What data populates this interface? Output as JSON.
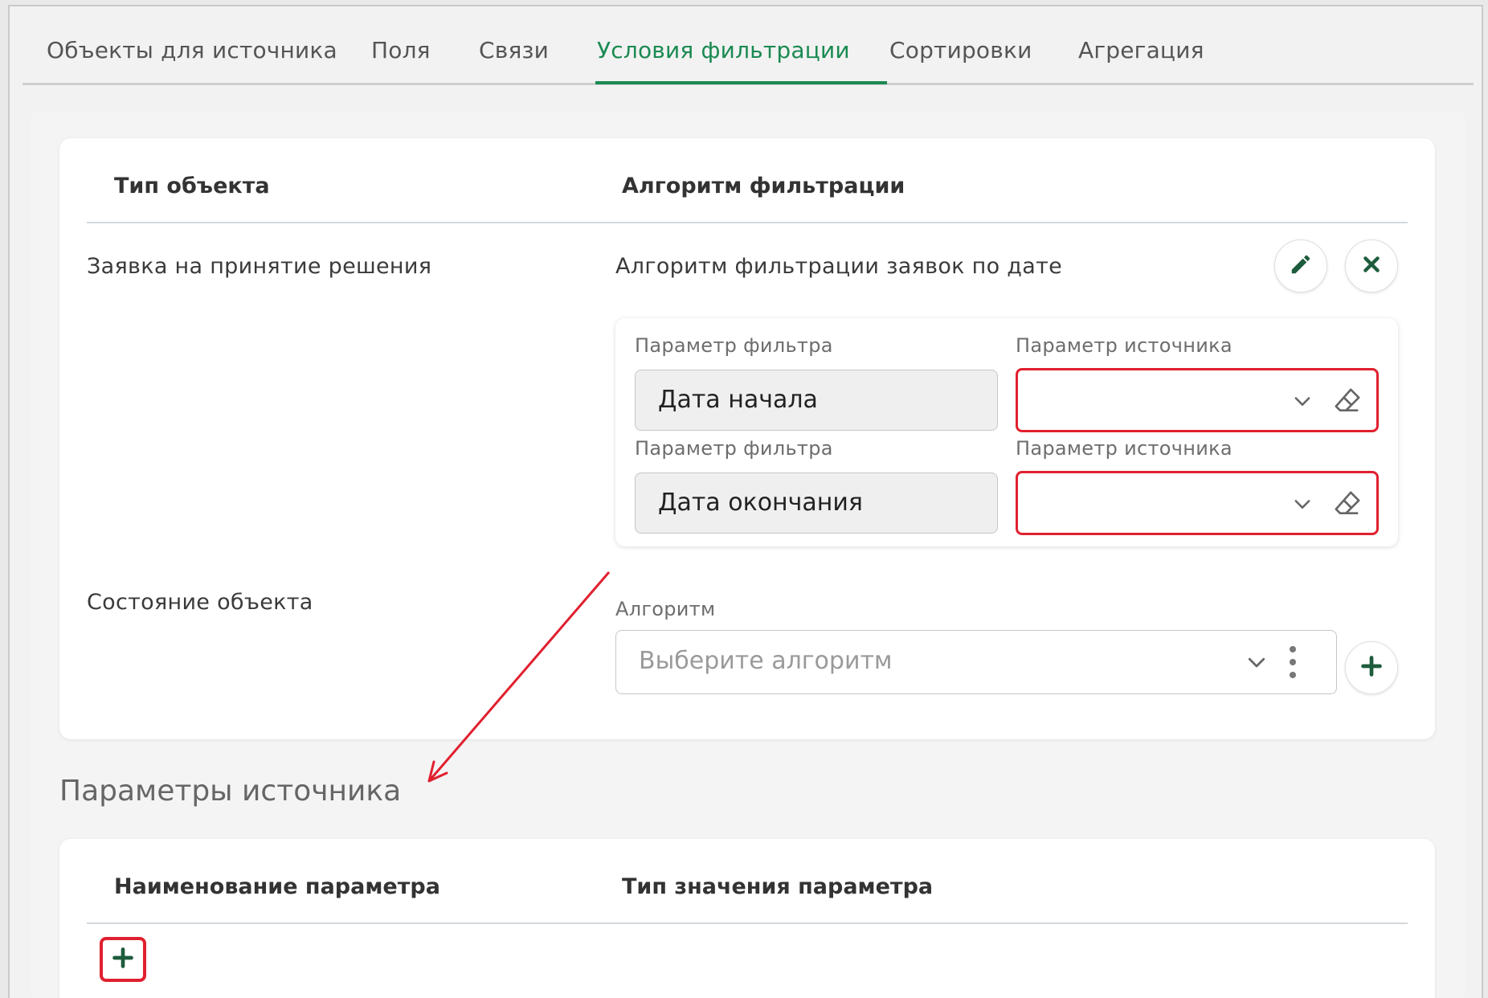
{
  "tabs": [
    {
      "label": "Объекты для источника",
      "active": false
    },
    {
      "label": "Поля",
      "active": false
    },
    {
      "label": "Связи",
      "active": false
    },
    {
      "label": "Условия фильтрации",
      "active": true
    },
    {
      "label": "Сортировки",
      "active": false
    },
    {
      "label": "Агрегация",
      "active": false
    }
  ],
  "filters_table": {
    "headers": {
      "object_type": "Тип объекта",
      "algorithm": "Алгоритм фильтрации"
    },
    "rows": [
      {
        "object_type": "Заявка на принятие решения",
        "algorithm": "Алгоритм фильтрации заявок по дате",
        "params": [
          {
            "filter_label": "Параметр фильтра",
            "filter_value": "Дата начала",
            "source_label": "Параметр источника",
            "source_value": ""
          },
          {
            "filter_label": "Параметр фильтра",
            "filter_value": "Дата окончания",
            "source_label": "Параметр источника",
            "source_value": ""
          }
        ]
      },
      {
        "object_type": "Состояние объекта",
        "algorithm_label": "Алгоритм",
        "algorithm_placeholder": "Выберите алгоритм"
      }
    ]
  },
  "source_params": {
    "title": "Параметры источника",
    "headers": {
      "name": "Наименование параметра",
      "value_type": "Тип значения параметра"
    }
  },
  "colors": {
    "accent": "#1a8a52",
    "highlight": "#e0202f",
    "icon_green": "#1d5c3c"
  },
  "icons": [
    "pencil-icon",
    "close-icon",
    "chevron-down-icon",
    "eraser-icon",
    "kebab-menu-icon",
    "plus-icon"
  ]
}
